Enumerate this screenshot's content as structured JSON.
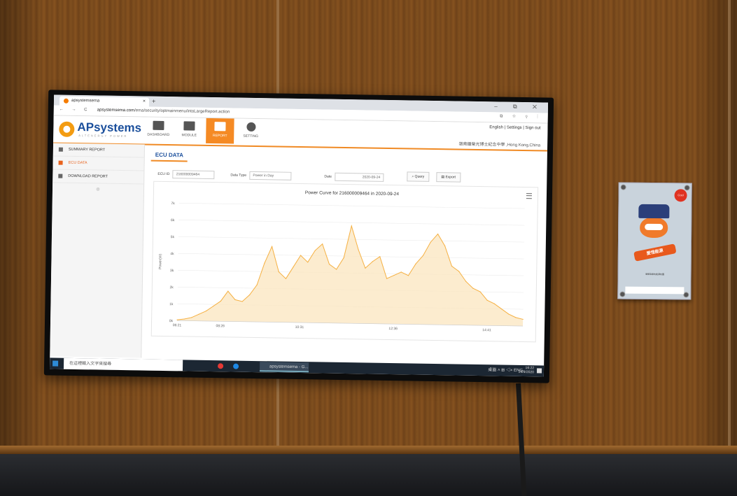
{
  "browser": {
    "tab_title": "apsystemsema",
    "tab_close": "×",
    "new_tab": "+",
    "window_controls": "‒ ⧉ ✕",
    "nav_buttons": "← → C",
    "url_domain": "apsystemsema.com",
    "url_path": "/ema/security/optmainmenu/intoLargeReport.action",
    "right_icons": "⧉ ☆ ⚲ ⋮"
  },
  "app": {
    "logo_text": "APsystems",
    "logo_sub": "ALTENERGY POWER",
    "nav": [
      {
        "label": "DASHBOARD",
        "icon": "monitor-icon"
      },
      {
        "label": "MODULE",
        "icon": "grid-icon"
      },
      {
        "label": "REPORT",
        "icon": "bar-chart-icon",
        "active": true
      },
      {
        "label": "SETTING",
        "icon": "gear-icon"
      }
    ],
    "header_links": "English  |  Settings  |  Sign out",
    "header_user": "嶺南鍾榮光博士紀念中學 ,Hong Kong,China",
    "accent_color": "#f58a24"
  },
  "sidebar": {
    "items": [
      {
        "label": "SUMMARY REPORT",
        "icon": "home-icon"
      },
      {
        "label": "ECU DATA",
        "icon": "chart-icon",
        "active": true
      },
      {
        "label": "DOWNLOAD REPORT",
        "icon": "download-icon"
      }
    ],
    "collapse": "⊗"
  },
  "main": {
    "title": "ECU DATA",
    "ecu_label": "ECU ID",
    "ecu_value": "216000009464",
    "dtype_label": "Data Type",
    "dtype_value": "Power in Day",
    "date_label": "Date",
    "date_value": "2020-09-24",
    "query_label": "Query",
    "export_label": "Export"
  },
  "chart_data": {
    "type": "area",
    "title": "Power Curve for 216000009464 in 2020-09-24",
    "ylabel": "Power(W)",
    "ylim": [
      0,
      7000
    ],
    "y_ticks": [
      "0k",
      "1k",
      "2k",
      "3k",
      "4k",
      "5k",
      "6k",
      "7k"
    ],
    "x_ticks": [
      "06:21",
      "08:26",
      "10:31",
      "12:36",
      "14:41"
    ],
    "x": [
      "06:21",
      "06:45",
      "07:10",
      "07:35",
      "07:55",
      "08:10",
      "08:26",
      "08:40",
      "08:55",
      "09:10",
      "09:25",
      "09:35",
      "09:45",
      "09:55",
      "10:05",
      "10:15",
      "10:25",
      "10:31",
      "10:40",
      "10:50",
      "11:00",
      "11:10",
      "11:20",
      "11:30",
      "11:40",
      "11:50",
      "12:00",
      "12:10",
      "12:20",
      "12:30",
      "12:36",
      "12:45",
      "12:55",
      "13:05",
      "13:15",
      "13:25",
      "13:35",
      "13:45",
      "13:55",
      "14:05",
      "14:15",
      "14:25",
      "14:35",
      "14:41",
      "15:00",
      "15:20",
      "15:40",
      "16:00",
      "16:20"
    ],
    "values": [
      50,
      100,
      200,
      400,
      600,
      900,
      1200,
      1800,
      1300,
      1200,
      1600,
      2200,
      3500,
      4500,
      3000,
      2600,
      3300,
      4000,
      3600,
      4300,
      4700,
      3500,
      3200,
      3900,
      5800,
      4400,
      3300,
      3700,
      4000,
      2700,
      2900,
      3100,
      2900,
      3600,
      4100,
      4900,
      5400,
      4700,
      3500,
      3200,
      2600,
      2200,
      2000,
      1500,
      1300,
      1000,
      700,
      500,
      400
    ],
    "color": "#f5b042",
    "fill": "#fbe6bf",
    "menu_icon": "hamburger-icon"
  },
  "taskbar": {
    "search_placeholder": "在這裡輸入文字來搜尋",
    "app_label": "apsystemsema - G...",
    "tray": "桌面 ˄ ⊞ ◁× ENG",
    "time": "16:22",
    "date": "24/9/2020"
  },
  "poster": {
    "banner": "愛惜能源",
    "badge": "Cool",
    "caption": "環保及節約能源校園"
  }
}
